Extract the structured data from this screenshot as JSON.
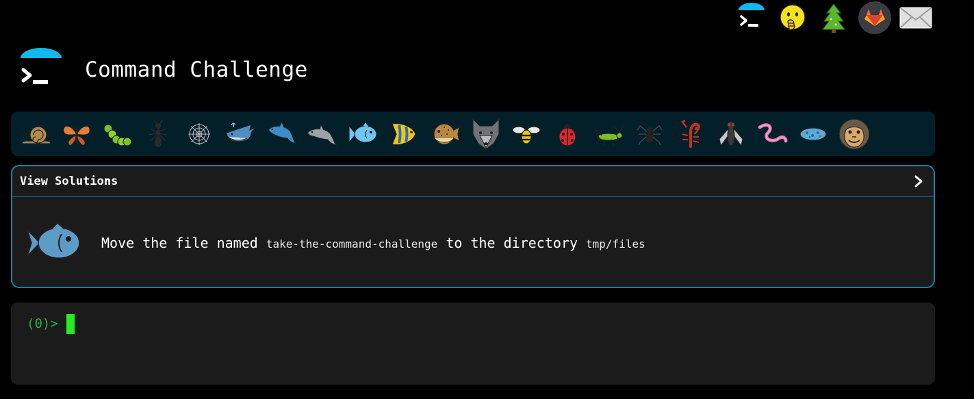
{
  "header": {
    "title": "Command Challenge",
    "logo_icon": "terminal-prompt-icon"
  },
  "top_icons": [
    {
      "name": "terminal-icon"
    },
    {
      "name": "hand-over-mouth-face-icon"
    },
    {
      "name": "evergreen-tree-icon"
    },
    {
      "name": "gitlab-icon"
    },
    {
      "name": "envelope-icon"
    }
  ],
  "challenges": [
    "snail",
    "butterfly",
    "caterpillar",
    "ant",
    "spider-web",
    "whale",
    "dolphin",
    "dolphin-grey",
    "fish",
    "tropical-fish",
    "blowfish",
    "wolf",
    "bee",
    "ladybug",
    "cricket",
    "spider",
    "scorpion",
    "fly",
    "worm",
    "microbe",
    "monkey"
  ],
  "panel": {
    "title": "View Solutions",
    "task_prefix": "Move the file named ",
    "task_file": "take-the-command-challenge",
    "task_middle": " to the directory ",
    "task_dir": "tmp/files",
    "task_icon": "fish-icon"
  },
  "terminal": {
    "prompt": "(0)>",
    "input_value": ""
  },
  "colors": {
    "background": "#000000",
    "strip": "#03202a",
    "panel": "#1b1b1b",
    "panel_border": "#1a7ea0",
    "prompt": "#22b14c",
    "cursor": "#22ee22",
    "accent": "#0fb9ec"
  }
}
